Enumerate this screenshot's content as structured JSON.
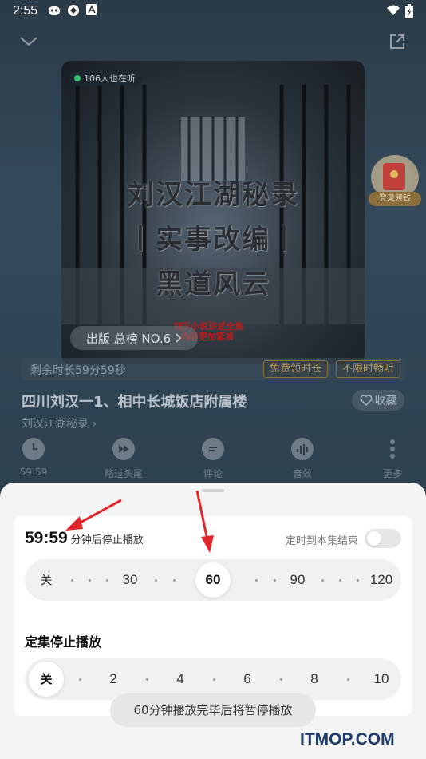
{
  "status_bar": {
    "time": "2:55"
  },
  "cover": {
    "listeners": "106人也在听",
    "title_lines": [
      "刘汉江湖秘录",
      "丨实事改编丨",
      "黑道风云"
    ],
    "red_text_lines": [
      "刘汉小说讲述全集",
      "内容更加紧凑"
    ],
    "rank": "出版 总榜 NO.6"
  },
  "gift": {
    "label": "登录领钱"
  },
  "remaining": {
    "text": "剩余时长59分59秒",
    "free_tag": "免费领时长",
    "unlimited_tag": "不限时畅听"
  },
  "episode": {
    "title": "四川刘汉一1、相中长城饭店附属楼",
    "album": "刘汉江湖秘录",
    "favorite": "收藏"
  },
  "actions": [
    {
      "label": "59:59",
      "icon": "timer-icon"
    },
    {
      "label": "略过头尾",
      "icon": "skip-icon"
    },
    {
      "label": "评论",
      "icon": "comment-icon"
    },
    {
      "label": "音效",
      "icon": "sound-effect-icon"
    },
    {
      "label": "更多",
      "icon": "more-icon"
    }
  ],
  "sleep_timer": {
    "countdown": "59:59",
    "countdown_suffix": "分钟后停止播放",
    "until_episode_end": "定时到本集结束",
    "until_episode_end_on": false,
    "minute_options": [
      "关",
      "30",
      "60",
      "90",
      "120"
    ],
    "minute_selected": "60",
    "episode_section_title": "定集停止播放",
    "episode_options": [
      "关",
      "2",
      "4",
      "6",
      "8",
      "10"
    ],
    "episode_selected": "关"
  },
  "toast": "60分钟播放完毕后将暂停播放",
  "watermark": "ITMOP.COM",
  "colors": {
    "arrow_red": "#e0262b",
    "accent_gold": "#b99a5d"
  }
}
